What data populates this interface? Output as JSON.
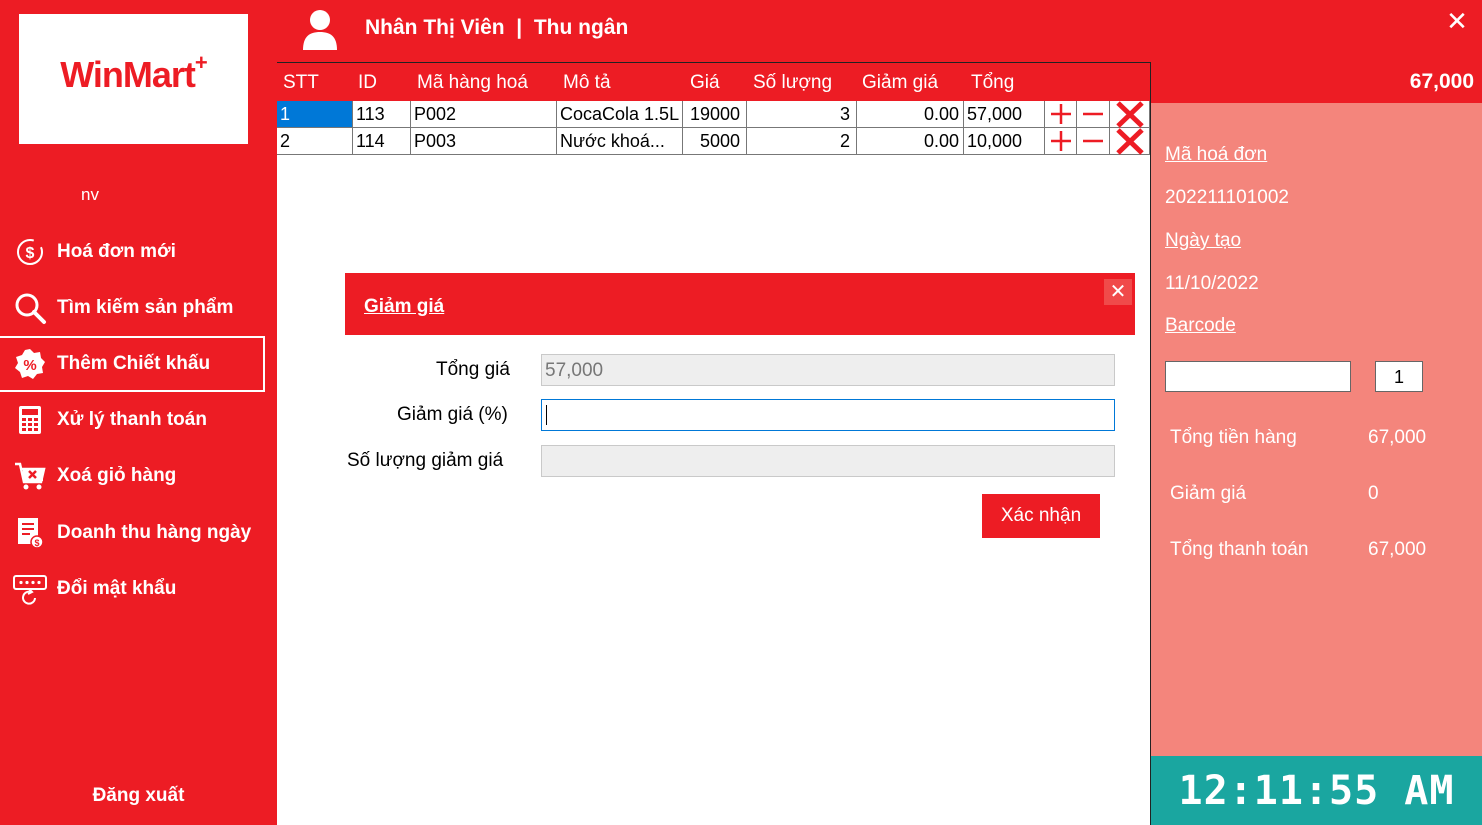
{
  "brand": {
    "logo_text": "WinMart",
    "logo_plus": "+"
  },
  "sidebar": {
    "user_short": "nv",
    "items": [
      {
        "label": "Hoá đơn mới",
        "icon": "dollar-refresh-icon"
      },
      {
        "label": "Tìm kiếm sản phẩm",
        "icon": "search-icon"
      },
      {
        "label": "Thêm Chiết khấu",
        "icon": "percent-badge-icon",
        "active": true
      },
      {
        "label": "Xử lý thanh toán",
        "icon": "calculator-icon"
      },
      {
        "label": "Xoá giỏ hàng",
        "icon": "cart-remove-icon"
      },
      {
        "label": "Doanh thu hàng ngày",
        "icon": "revenue-report-icon"
      },
      {
        "label": "Đổi mật khẩu",
        "icon": "password-refresh-icon"
      }
    ],
    "logout": "Đăng xuất"
  },
  "header": {
    "title": "Nhân Thị Viên  |  Thu ngân",
    "total": "67,000"
  },
  "grid": {
    "columns": [
      "STT",
      "ID",
      "Mã hàng hoá",
      "Mô tả",
      "Giá",
      "Số lượng",
      "Giảm giá",
      "Tổng"
    ],
    "rows": [
      {
        "stt": "1",
        "id": "113",
        "code": "P002",
        "desc": "CocaCola 1.5L",
        "price": "19000",
        "qty": "3",
        "discount": "0.00",
        "total": "57,000"
      },
      {
        "stt": "2",
        "id": "114",
        "code": "P003",
        "desc": "Nước khoá...",
        "price": "5000",
        "qty": "2",
        "discount": "0.00",
        "total": "10,000"
      }
    ]
  },
  "dialog": {
    "title": "Giảm giá",
    "labels": {
      "total_price": "Tổng giá",
      "discount_percent": "Giảm giá (%)",
      "discount_qty": "Số lượng giảm giá"
    },
    "values": {
      "total_price": "57,000",
      "discount_percent": "",
      "discount_qty": ""
    },
    "confirm": "Xác nhận"
  },
  "right_panel": {
    "invoice_label": "Mã hoá đơn",
    "invoice_value": "202211101002",
    "date_label": "Ngày tạo",
    "date_value": "11/10/2022",
    "barcode_label": "Barcode",
    "qty_value": "1",
    "summary": [
      {
        "label": "Tổng tiền hàng",
        "value": "67,000"
      },
      {
        "label": "Giảm giá",
        "value": "0"
      },
      {
        "label": "Tổng thanh toán",
        "value": "67,000"
      }
    ],
    "clock": "12:11:55 AM"
  },
  "colors": {
    "primary": "#ed1c24",
    "panel": "#f4857c",
    "clock_bg": "#1aa6a0",
    "selection": "#0078d7"
  }
}
